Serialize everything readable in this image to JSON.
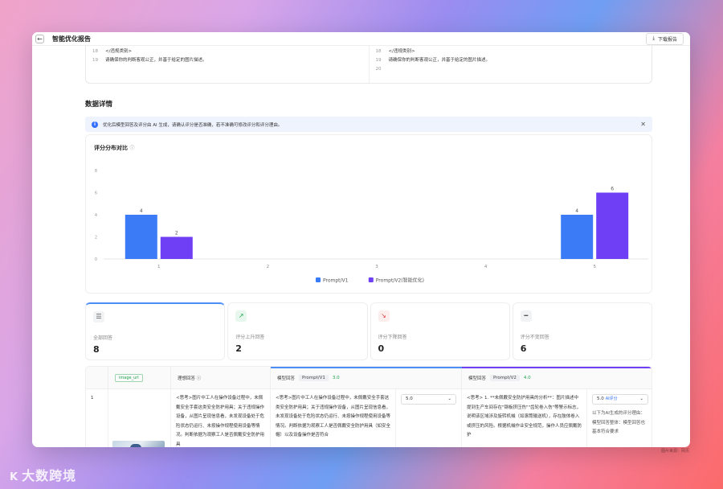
{
  "window": {
    "back_icon": "back-arrow-icon",
    "title": "智能优化报告",
    "download_label": "下载报告",
    "download_icon": "download-icon"
  },
  "code_compare": {
    "left": [
      {
        "n": "18",
        "t": "</违规类别>"
      },
      {
        "n": "19",
        "t": "请确保你的判断客观公正，并基于给定的图片描述。"
      }
    ],
    "right": [
      {
        "n": "18",
        "t": "</违规类别>"
      },
      {
        "n": "19",
        "t": "请确保你的判断客观公正，并基于给定的图片描述。"
      },
      {
        "n": "20",
        "t": ""
      }
    ]
  },
  "details": {
    "section_title": "数据详情",
    "notice": "优化后模型回答及评分由 AI 生成，请确认评分是否准确，若不准确可修改评分和评分理由。",
    "notice_icon": "info-icon",
    "close_icon": "close-icon"
  },
  "chart_data": {
    "type": "bar",
    "title": "评分分布对比",
    "categories": [
      "1",
      "2",
      "3",
      "4",
      "5"
    ],
    "series": [
      {
        "name": "Prompt/V1",
        "values": [
          4,
          0,
          0,
          0,
          4
        ],
        "color": "#3b7cf6"
      },
      {
        "name": "Prompt/V2(智能优化)",
        "values": [
          2,
          0,
          0,
          0,
          6
        ],
        "color": "#6e3ff5"
      }
    ],
    "ylim": [
      0,
      8
    ],
    "yticks": [
      "0",
      "2",
      "4",
      "6",
      "8"
    ],
    "grid": false,
    "legend": "bottom-center"
  },
  "stats": [
    {
      "icon": "list-icon",
      "label": "全部回答",
      "value": "8"
    },
    {
      "icon": "trend-up-icon",
      "label": "评分上升回答",
      "value": "2"
    },
    {
      "icon": "trend-down-icon",
      "label": "评分下降回答",
      "value": "0"
    },
    {
      "icon": "minus-icon",
      "label": "评分不变回答",
      "value": "6"
    }
  ],
  "table": {
    "headers": {
      "image": "image_url",
      "ideal": "理想回答",
      "ideal_help_icon": "help-icon",
      "model1": "模型回答",
      "model1_tag": "Prompt/V1",
      "model1_score": "3.0",
      "model2": "模型回答",
      "model2_tag": "Prompt/V2",
      "model2_score": "4.0"
    },
    "row": {
      "index": "1",
      "ideal_text": "<思考>图片中工人在操作设备过程中，未佩戴安全手套这类安全防护用具；关于违规操作设备，从图片呈现信息看，未发现设备处于危险状态仍运行、未按操作规程使用设备等情况。判断依据为观察工人是否佩戴安全防护用具",
      "model1_text": "<思考>图片中工人在操作设备过程中，未佩戴安全手套这类安全防护用具；关于违规操作设备，从图片呈现信息看，未发现设备处于危险状态仍运行、未按操作规程使用设备等情况。判断依据为观察工人是否佩戴安全防护用具（如安全帽）以及设备操作是否符合",
      "model1_score": "5.0",
      "model2_text": "<思考> 1. **未佩戴安全防护用具的分析**：图片描述中提到生产车间存在\"钢板挤压伤\"\"齿轮卷入伤\"等警示标志，说明该区域涉及旋转机械（如滚筒输送机），存在肢体卷入或挤压的风险。根据机械作业安全规范，操作人员应佩戴防护",
      "model2_score": "5.0",
      "model2_ai": "AI评分",
      "reason": "以下为AI生成的评分理由：模型回答整体：模型回答也基本符合要求",
      "chevron_icon": "chevron-down-icon"
    }
  },
  "watermark": {
    "brand": "大数跨境",
    "logo": "K"
  },
  "source_note": "图片来源：网页"
}
